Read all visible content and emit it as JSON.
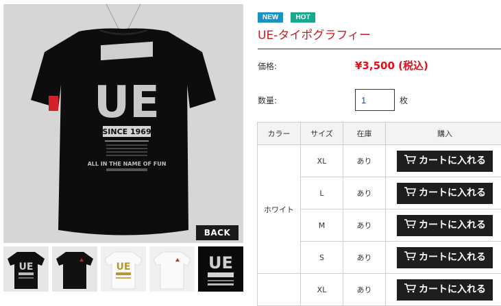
{
  "main_image": {
    "back_label": "BACK"
  },
  "badges": {
    "new": "NEW",
    "hot": "HOT"
  },
  "product": {
    "title": "UE-タイポグラフィー",
    "price_label": "価格:",
    "price": "¥3,500 (税込)",
    "qty_label": "数量:",
    "qty_value": "1",
    "qty_unit": "枚"
  },
  "table": {
    "headers": [
      "カラー",
      "サイズ",
      "在庫",
      "購入"
    ],
    "color": "ホワイト",
    "rows": [
      {
        "size": "XL",
        "stock": "あり",
        "cart": "カートに入れる"
      },
      {
        "size": "L",
        "stock": "あり",
        "cart": "カートに入れる"
      },
      {
        "size": "M",
        "stock": "あり",
        "cart": "カートに入れる"
      },
      {
        "size": "S",
        "stock": "あり",
        "cart": "カートに入れる"
      },
      {
        "size": "XL",
        "stock": "あり",
        "cart": "カートに入れる"
      }
    ]
  },
  "shirt_print": {
    "big_text": "UE",
    "since": "SINCE 1969",
    "bottom": "ALL IN THE NAME OF FUN"
  },
  "colors": {
    "title_red": "#c71c22",
    "price_red": "#e0101a",
    "badge_new": "#1a92c2",
    "badge_hot": "#17a88e",
    "button_dark": "#1e1e1e",
    "header_bg": "#f3f3f3"
  },
  "icons": {
    "cart": "cart-icon"
  }
}
